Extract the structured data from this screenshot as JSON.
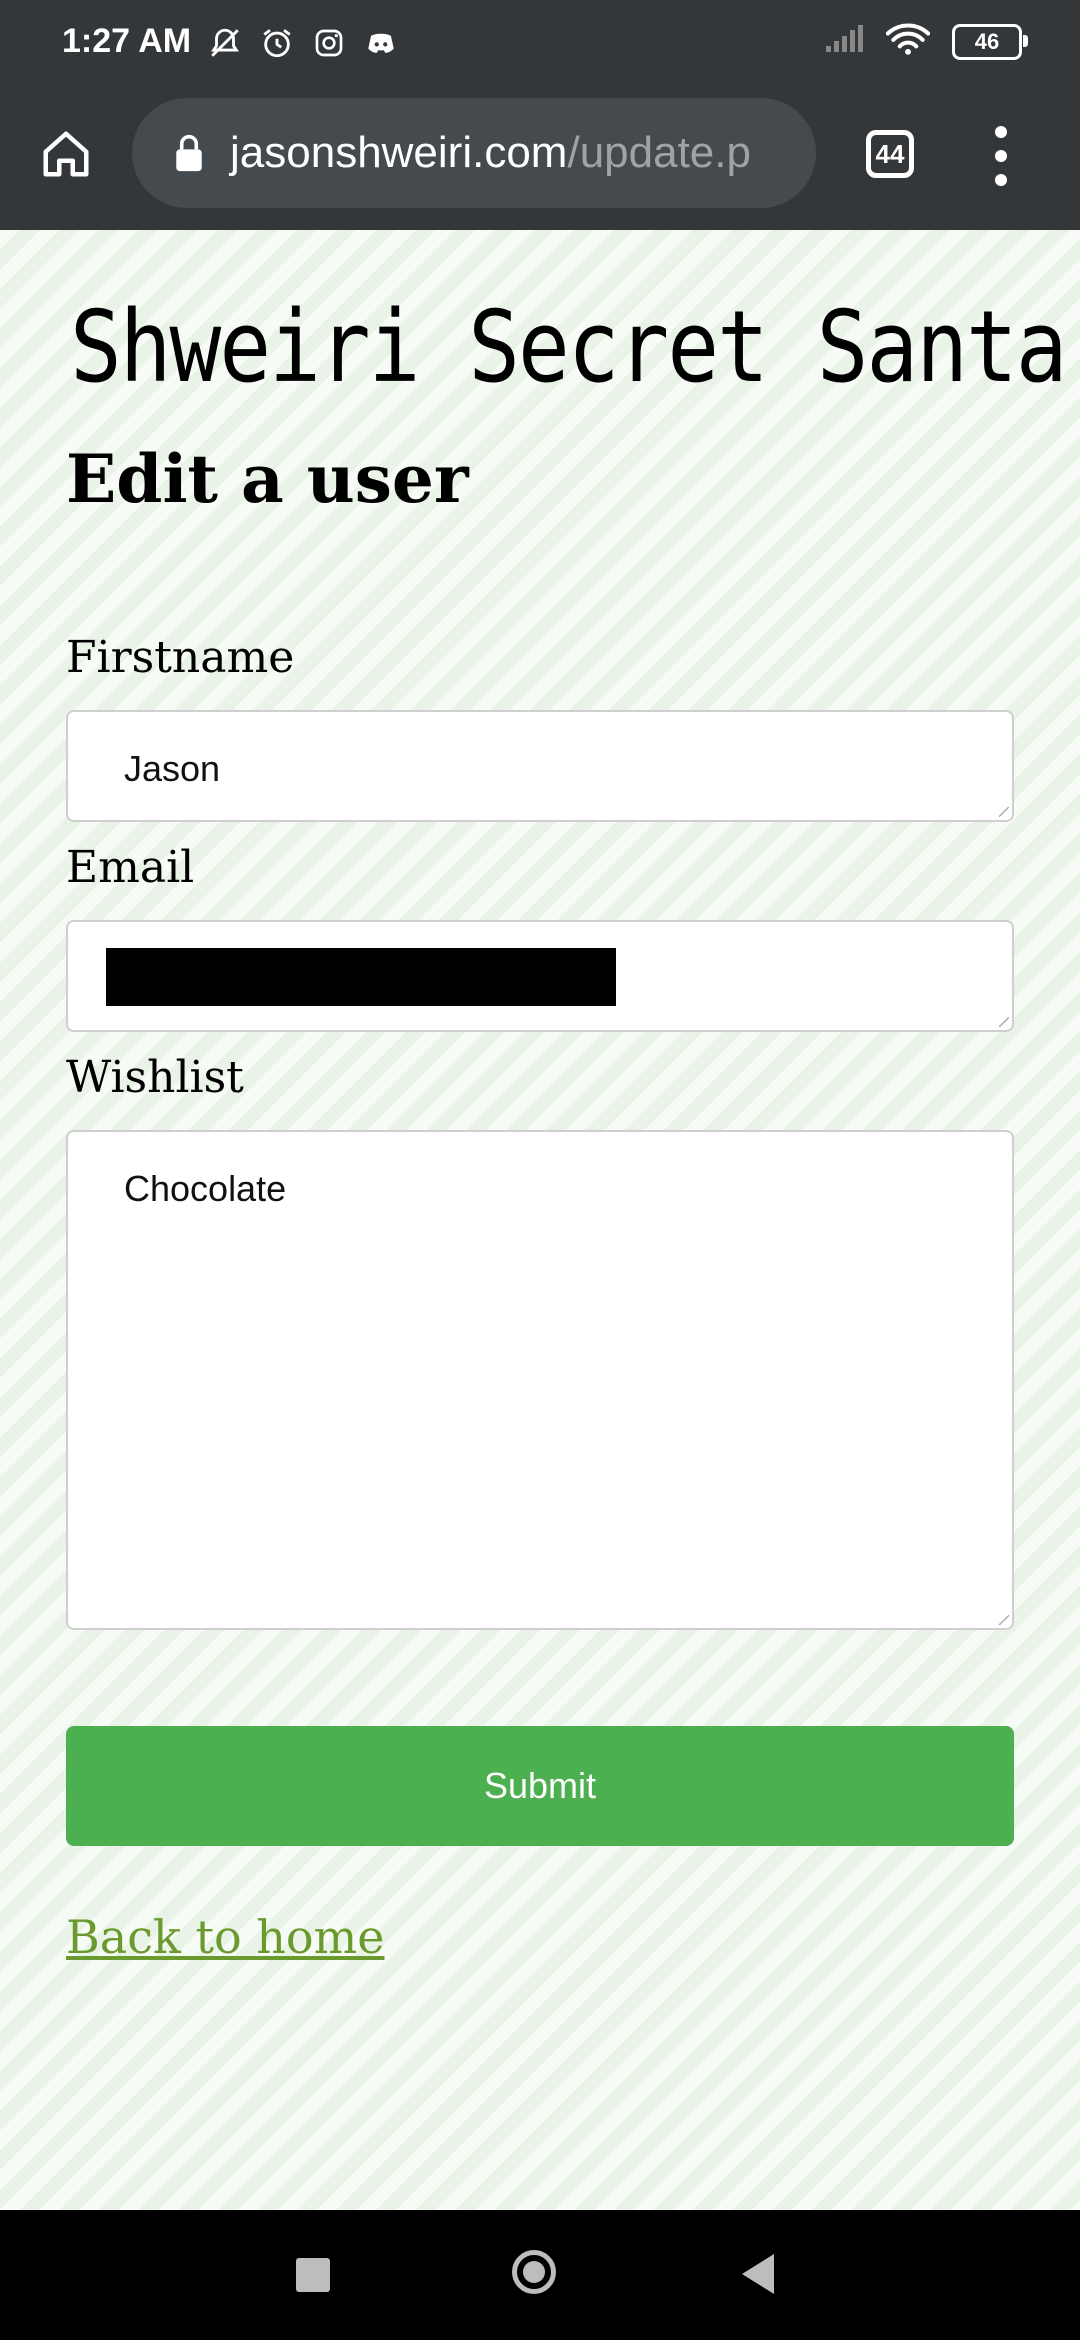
{
  "status_bar": {
    "time": "1:27 AM",
    "battery": "46",
    "left_icons": [
      "mute-icon",
      "alarm-icon",
      "instagram-icon",
      "discord-icon"
    ],
    "right_icons": [
      "signal-icon",
      "wifi-icon",
      "battery-icon"
    ]
  },
  "browser": {
    "url_host": "jasonshweiri.com",
    "url_path": "/update.p",
    "tab_count": "44"
  },
  "page": {
    "site_title": "Shweiri Secret Santa",
    "heading": "Edit a user",
    "form": {
      "firstname_label": "Firstname",
      "firstname_value": "Jason",
      "email_label": "Email",
      "wishlist_label": "Wishlist",
      "wishlist_value": "Chocolate",
      "submit_label": "Submit"
    },
    "back_link": "Back to home"
  },
  "colors": {
    "toolbar": "#34373a",
    "submit": "#4caf50",
    "link": "#6a9a2e",
    "page_bg": "#eef6ec"
  }
}
